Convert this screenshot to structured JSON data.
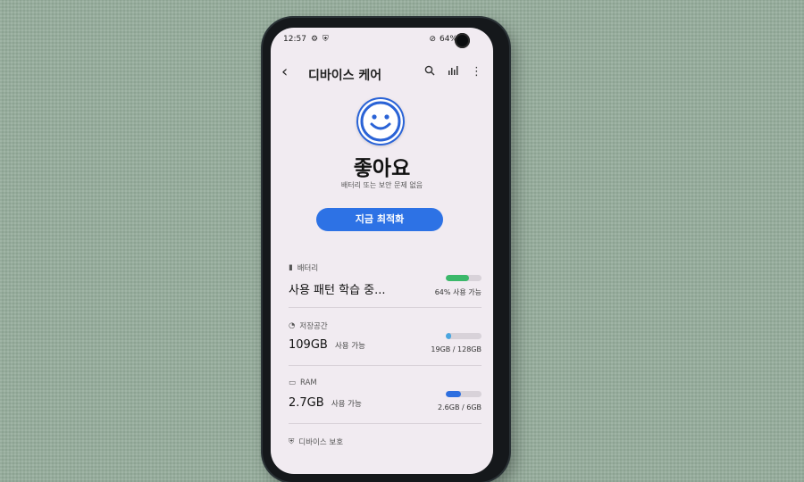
{
  "status": {
    "time": "12:57",
    "battery": "64%"
  },
  "appbar": {
    "title": "디바이스 케어"
  },
  "health": {
    "title": "좋아요",
    "subtitle": "배터리 또는 보안 문제 없음"
  },
  "optimize_label": "지금 최적화",
  "cards": [
    {
      "label": "배터리",
      "value": "사용 패턴 학습 중...",
      "value_suffix": "",
      "right": "64% 사용 가능",
      "fill": 0.64,
      "color": "#3bb86a"
    },
    {
      "label": "저장공간",
      "value": "109GB",
      "value_suffix": "사용 가능",
      "right": "19GB / 128GB",
      "fill": 0.15,
      "color": "#4aa6e0"
    },
    {
      "label": "RAM",
      "value": "2.7GB",
      "value_suffix": "사용 가능",
      "right": "2.6GB / 6GB",
      "fill": 0.43,
      "color": "#2e6fe0"
    },
    {
      "label": "디바이스 보호"
    }
  ],
  "icons": [
    "gear-icon",
    "shield-icon",
    "mute-icon",
    "search-icon",
    "stats-icon",
    "more-icon"
  ]
}
